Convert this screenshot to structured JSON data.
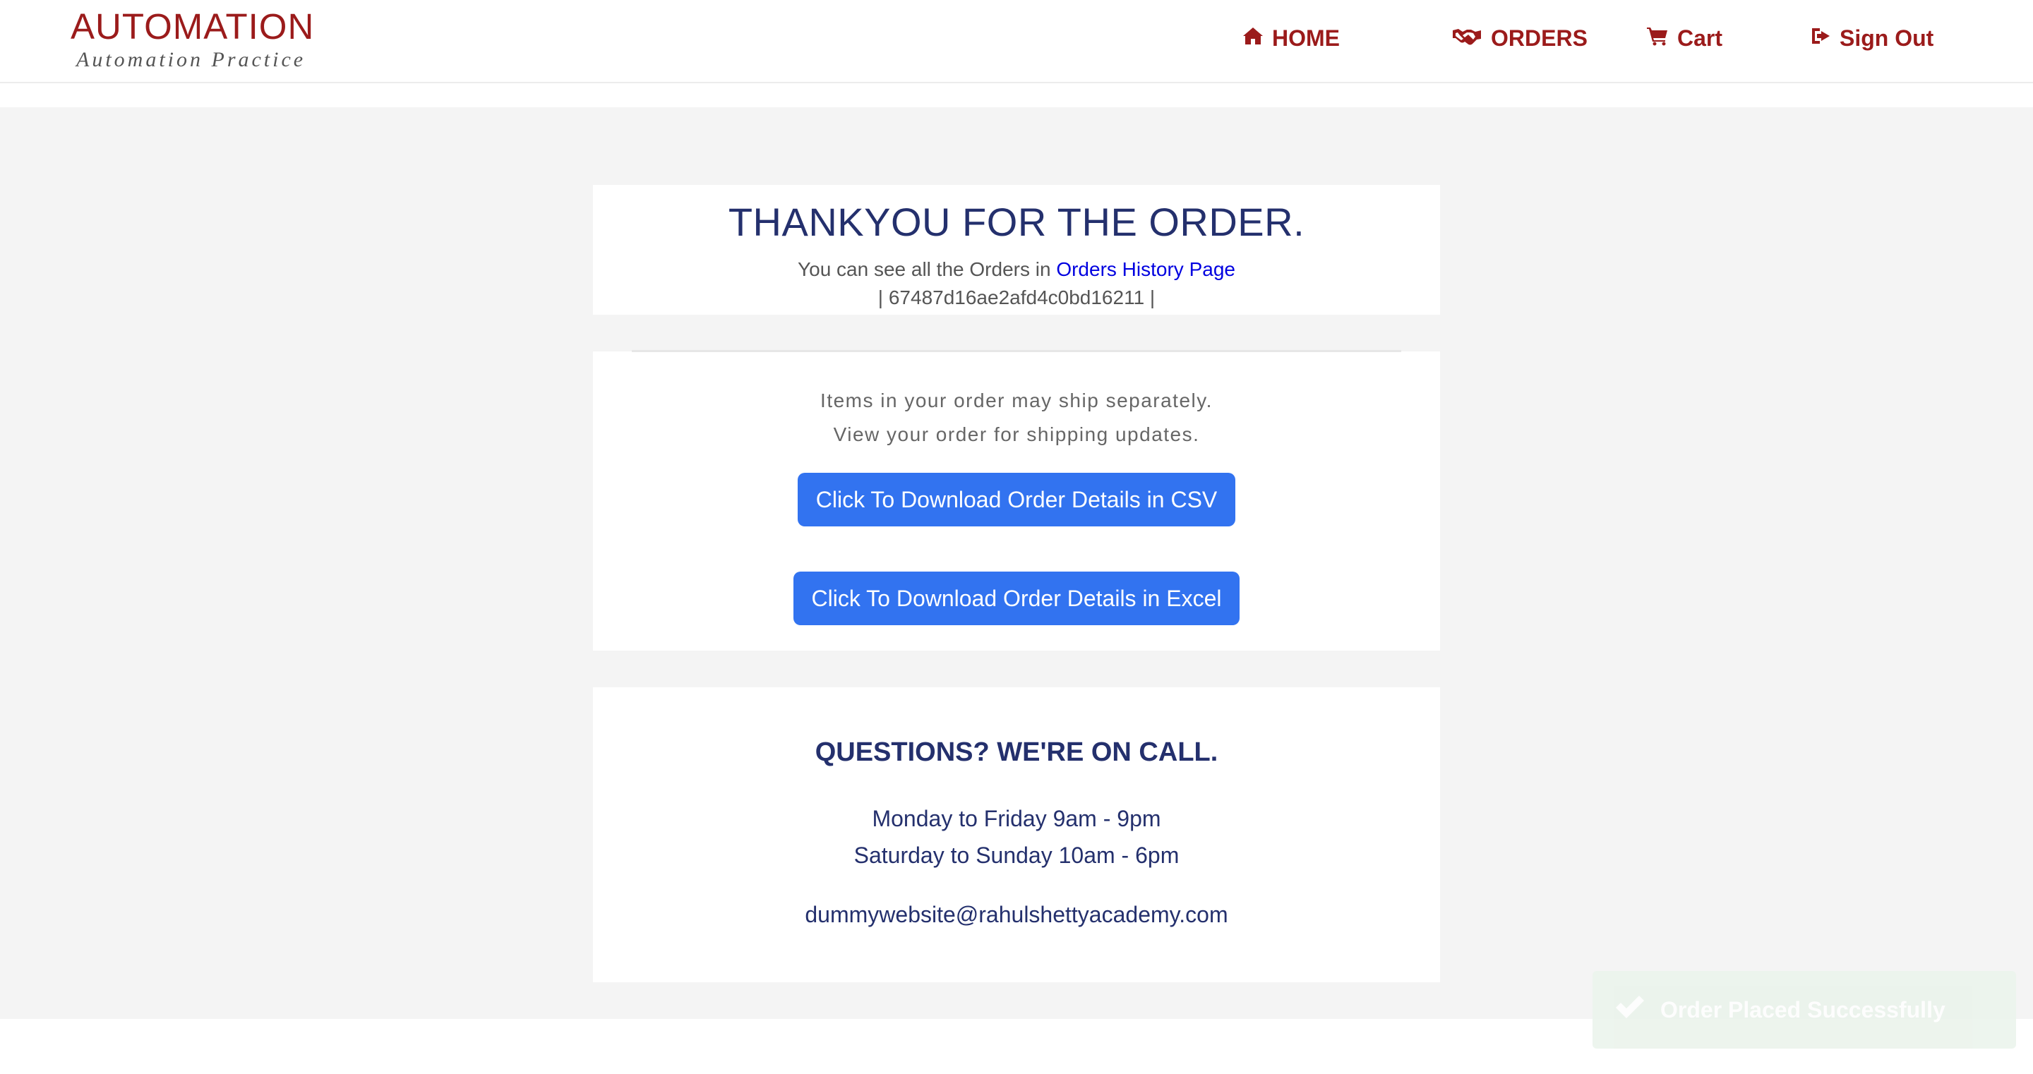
{
  "brand": {
    "title": "AUTOMATION",
    "subtitle": "Automation Practice",
    "color": "#9b1b1b"
  },
  "nav": {
    "home": {
      "label": "HOME",
      "icon": "home-icon"
    },
    "orders": {
      "label": "ORDERS",
      "icon": "handshake-icon"
    },
    "cart": {
      "label": "Cart",
      "icon": "cart-icon"
    },
    "signout": {
      "label": "Sign Out",
      "icon": "sign-out-icon"
    }
  },
  "thanks": {
    "title": "THANKYOU FOR THE ORDER.",
    "orders_text": "You can see all the Orders in",
    "orders_link": "Orders History Page",
    "order_id": "| 67487d16ae2afd4c0bd16211 |"
  },
  "shipping": {
    "line1": "Items in your order may ship separately.",
    "line2": "View your order for shipping updates.",
    "csv_button": "Click To Download Order Details in CSV",
    "excel_button": "Click To Download Order Details in Excel"
  },
  "help": {
    "title": "QUESTIONS? WE'RE ON CALL.",
    "weekday_hours": "Monday to Friday 9am - 9pm",
    "weekend_hours": "Saturday to Sunday 10am - 6pm",
    "email": "dummywebsite@rahulshettyacademy.com"
  },
  "toast": {
    "message": "Order Placed Successfully",
    "icon": "check-icon"
  },
  "colors": {
    "accent": "#9b1b1b",
    "heading": "#24306d",
    "button": "#3273f0",
    "link": "#0000e0",
    "background": "#f4f4f4"
  }
}
